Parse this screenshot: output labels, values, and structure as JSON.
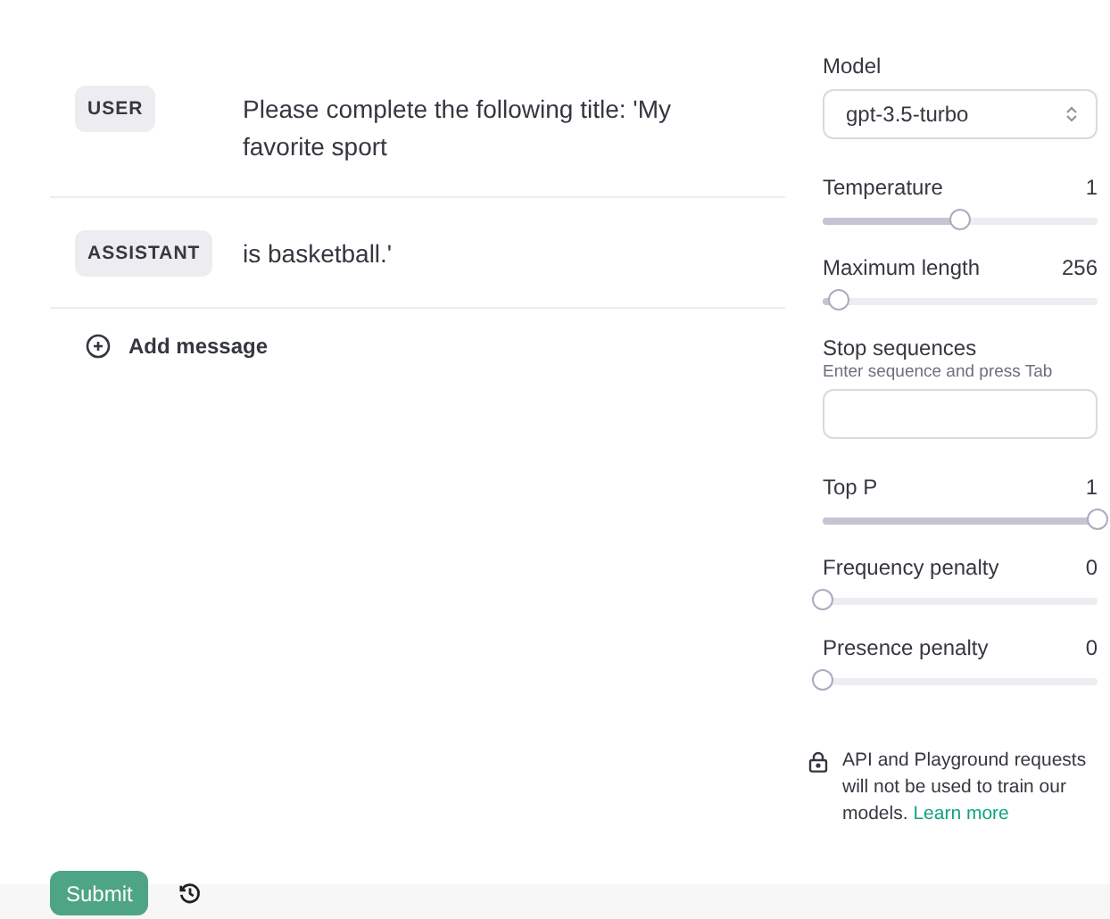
{
  "messages": [
    {
      "role": "USER",
      "text": "Please complete the following title: 'My favorite sport"
    },
    {
      "role": "ASSISTANT",
      "text": "is basketball.'"
    }
  ],
  "add_message": "Add message",
  "settings": {
    "model_label": "Model",
    "model_value": "gpt-3.5-turbo",
    "sliders_top": [
      {
        "label": "Temperature",
        "reading": "1",
        "level": 0.5
      },
      {
        "label": "Maximum length",
        "reading": "256",
        "level": 0.06
      }
    ],
    "stop": {
      "label": "Stop sequences",
      "hint": "Enter sequence and press Tab"
    },
    "sliders_bottom": [
      {
        "label": "Top P",
        "reading": "1",
        "level": 1
      },
      {
        "label": "Frequency penalty",
        "reading": "0",
        "level": 0
      },
      {
        "label": "Presence penalty",
        "reading": "0",
        "level": 0
      }
    ],
    "notice": {
      "text": "API and Playground requests will not be used to train our models.",
      "link": "Learn more"
    }
  },
  "submit": "Submit"
}
